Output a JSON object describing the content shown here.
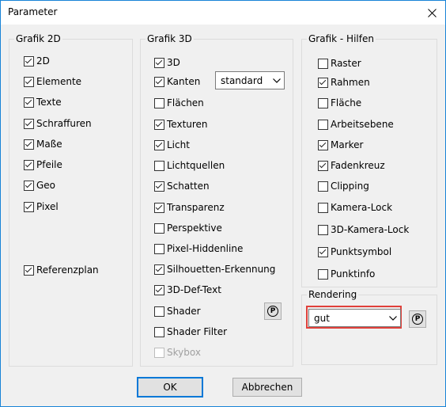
{
  "window": {
    "title": "Parameter"
  },
  "groups": {
    "grafik2d": {
      "title": "Grafik 2D",
      "items": [
        {
          "label": "2D",
          "checked": true
        },
        {
          "label": "Elemente",
          "checked": true
        },
        {
          "label": "Texte",
          "checked": true
        },
        {
          "label": "Schraffuren",
          "checked": true
        },
        {
          "label": "Maße",
          "checked": true
        },
        {
          "label": "Pfeile",
          "checked": true
        },
        {
          "label": "Geo",
          "checked": true
        },
        {
          "label": "Pixel",
          "checked": true
        },
        {
          "label": "Referenzplan",
          "checked": true
        }
      ]
    },
    "grafik3d": {
      "title": "Grafik 3D",
      "items": [
        {
          "label": "3D",
          "checked": true
        },
        {
          "label": "Kanten",
          "checked": true
        },
        {
          "label": "Flächen",
          "checked": false
        },
        {
          "label": "Texturen",
          "checked": true
        },
        {
          "label": "Licht",
          "checked": true
        },
        {
          "label": "Lichtquellen",
          "checked": false
        },
        {
          "label": "Schatten",
          "checked": true
        },
        {
          "label": "Transparenz",
          "checked": true
        },
        {
          "label": "Perspektive",
          "checked": false
        },
        {
          "label": "Pixel-Hiddenline",
          "checked": false
        },
        {
          "label": "Silhouetten-Erkennung",
          "checked": true
        },
        {
          "label": "3D-Def-Text",
          "checked": true
        },
        {
          "label": "Shader",
          "checked": false
        },
        {
          "label": "Shader Filter",
          "checked": false
        },
        {
          "label": "Skybox",
          "checked": false,
          "disabled": true
        }
      ],
      "kanten_select": "standard",
      "shader_button": "P"
    },
    "hilfen": {
      "title": "Grafik - Hilfen",
      "items": [
        {
          "label": "Raster",
          "checked": false
        },
        {
          "label": "Rahmen",
          "checked": true
        },
        {
          "label": "Fläche",
          "checked": false
        },
        {
          "label": "Arbeitsebene",
          "checked": false
        },
        {
          "label": "Marker",
          "checked": true
        },
        {
          "label": "Fadenkreuz",
          "checked": true
        },
        {
          "label": "Clipping",
          "checked": false
        },
        {
          "label": "Kamera-Lock",
          "checked": false
        },
        {
          "label": "3D-Kamera-Lock",
          "checked": false
        },
        {
          "label": "Punktsymbol",
          "checked": true
        },
        {
          "label": "Punktinfo",
          "checked": false
        }
      ]
    },
    "rendering": {
      "title": "Rendering",
      "select": "gut",
      "button": "P",
      "highlight_color": "#e0403a"
    }
  },
  "buttons": {
    "ok": "OK",
    "cancel": "Abbrechen"
  },
  "icons": {
    "close": "close-icon",
    "chevron": "chevron-down-icon"
  }
}
